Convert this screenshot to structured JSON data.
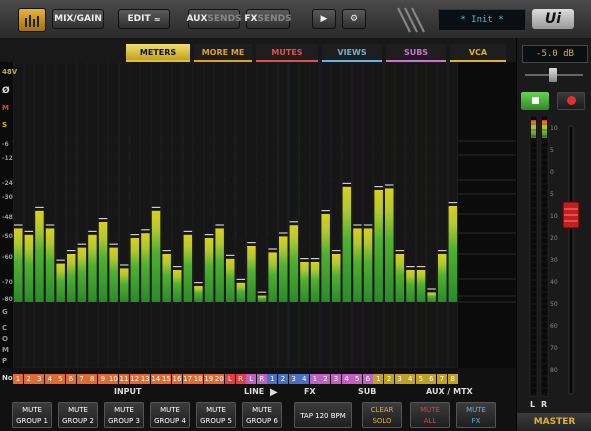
{
  "topbar": {
    "mix_gain": "MIX/GAIN",
    "edit": "EDIT",
    "aux": "AUX",
    "aux_sends": "SENDS",
    "fx": "FX",
    "fx_sends": "SENDS",
    "preset": "* Init *",
    "logo": "Ui"
  },
  "tabs": [
    {
      "label": "METERS",
      "color": "#111",
      "active": true
    },
    {
      "label": "MORE ME",
      "color": "#e0a030"
    },
    {
      "label": "MUTES",
      "color": "#e05050"
    },
    {
      "label": "VIEWS",
      "color": "#6ab0e0"
    },
    {
      "label": "SUBS",
      "color": "#d070d0"
    },
    {
      "label": "VCA",
      "color": "#e0b030"
    }
  ],
  "row_labels": {
    "phantom": "48V",
    "phase": "Ø",
    "mute": "M",
    "solo": "S",
    "scale": [
      "-6",
      "-12",
      "-24",
      "-30",
      "-48",
      "-50",
      "-60",
      "-70",
      "-80"
    ],
    "gate": "G",
    "comp": [
      "C",
      "O",
      "M",
      "P"
    ],
    "no": "No"
  },
  "channels": {
    "input": [
      "1",
      "2",
      "3",
      "4",
      "5",
      "6",
      "7",
      "8",
      "9",
      "10",
      "11",
      "12",
      "13",
      "14",
      "15",
      "16",
      "17",
      "18",
      "19",
      "20"
    ],
    "line": [
      "L",
      "R",
      "L",
      "R"
    ],
    "fx": [
      "1",
      "2",
      "3",
      "4"
    ],
    "sub": [
      "1",
      "2",
      "3",
      "4",
      "5",
      "6"
    ],
    "aux": [
      "1",
      "2",
      "3",
      "4",
      "5",
      "6",
      "7",
      "8"
    ]
  },
  "groups": {
    "input": "INPUT",
    "line": "LINE",
    "fx": "FX",
    "sub": "SUB",
    "aux": "AUX / MTX"
  },
  "buttons": {
    "mute_groups": [
      [
        "MUTE",
        "GROUP 1"
      ],
      [
        "MUTE",
        "GROUP 2"
      ],
      [
        "MUTE",
        "GROUP 3"
      ],
      [
        "MUTE",
        "GROUP 4"
      ],
      [
        "MUTE",
        "GROUP 5"
      ],
      [
        "MUTE",
        "GROUP 6"
      ]
    ],
    "tap": "TAP 120 BPM",
    "clear_solo": [
      "CLEAR",
      "SOLO"
    ],
    "mute_all": [
      "MUTE",
      "ALL"
    ],
    "mute_fx": [
      "MUTE",
      "FX"
    ]
  },
  "master": {
    "gain": "-5.0 dB",
    "label": "MASTER",
    "l": "L",
    "r": "R",
    "scale": [
      "10",
      "5",
      "0",
      "5",
      "10",
      "20",
      "30",
      "40",
      "50",
      "60",
      "70",
      "80"
    ]
  },
  "meter_levels": [
    0.46,
    0.42,
    0.57,
    0.46,
    0.24,
    0.3,
    0.34,
    0.42,
    0.5,
    0.34,
    0.21,
    0.4,
    0.43,
    0.57,
    0.3,
    0.2,
    0.42,
    0.1,
    0.4,
    0.46,
    0.27,
    0.12,
    0.35,
    0.04,
    0.31,
    0.41,
    0.48,
    0.25,
    0.25,
    0.55,
    0.3,
    0.72,
    0.46,
    0.46,
    0.7,
    0.71,
    0.3,
    0.2,
    0.2,
    0.06,
    0.3,
    0.6,
    0.38,
    0.3,
    0.24,
    0.29,
    0.15,
    0.5,
    0.36,
    0.38,
    0.42,
    0.3,
    0.28,
    0.07,
    0.38,
    0.46,
    0.47,
    0.46,
    0.32,
    0.43,
    0.48,
    0.51,
    0.4,
    0.56,
    0.42,
    0.28,
    0.47,
    0.49
  ]
}
